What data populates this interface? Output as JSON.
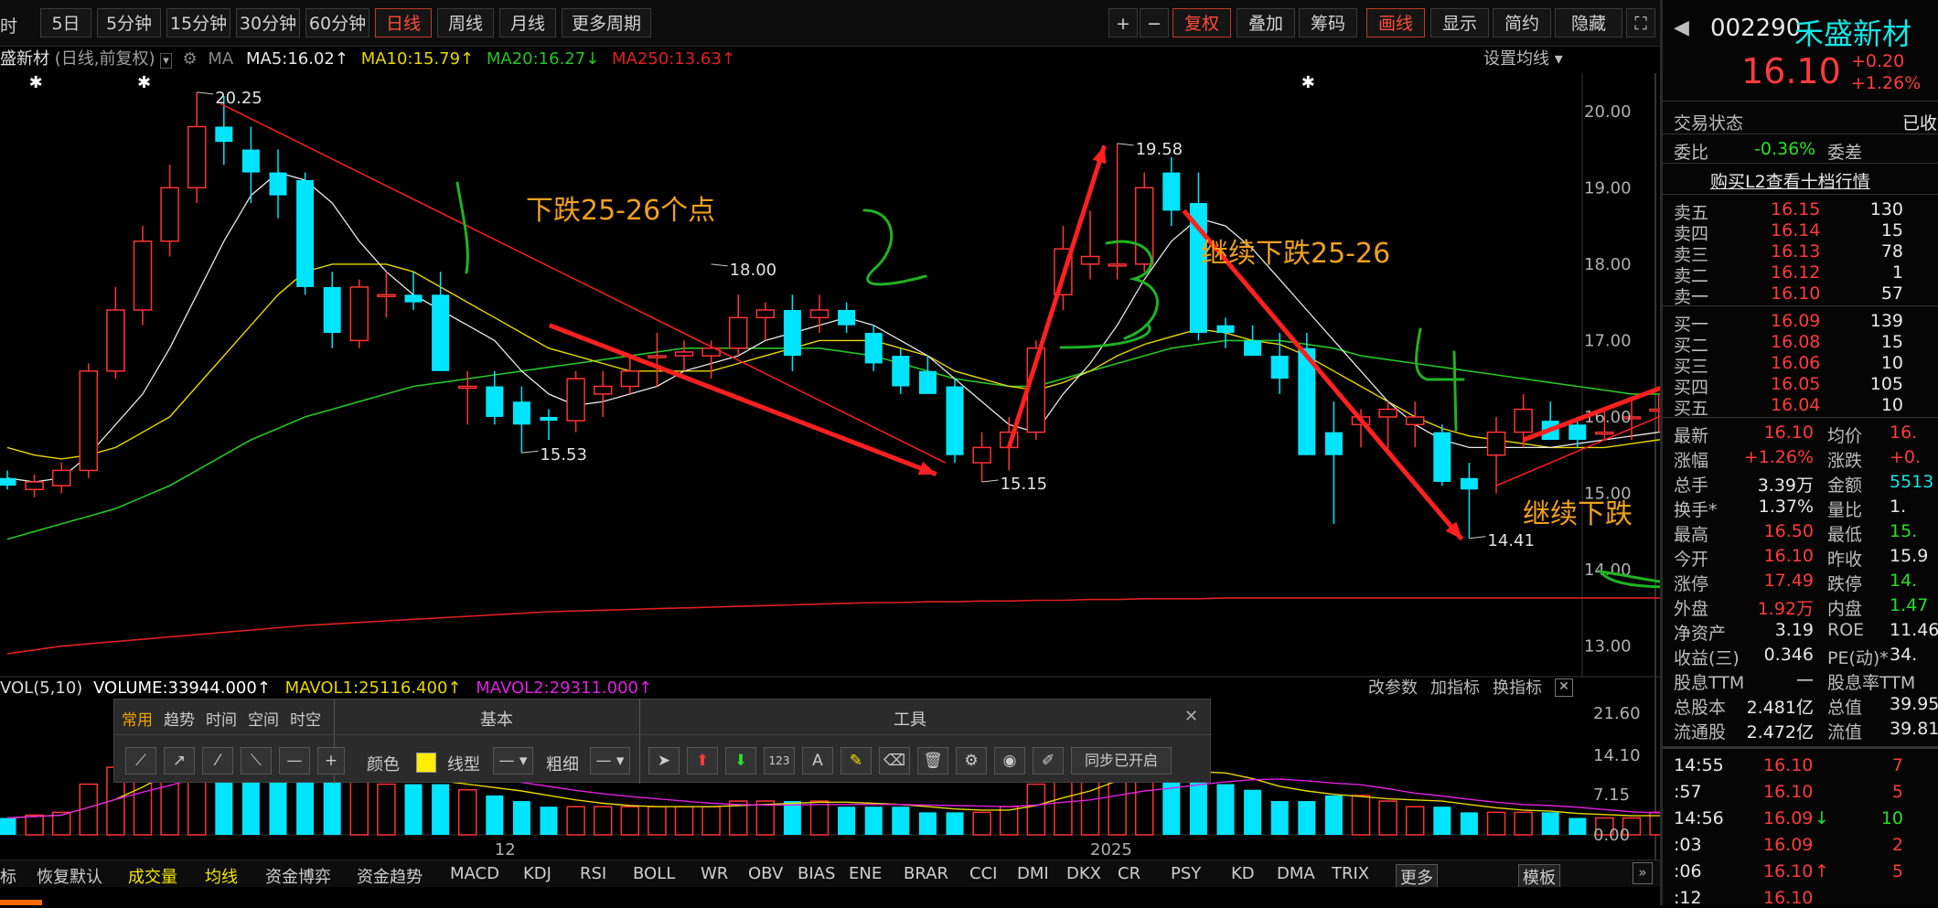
{
  "toolbar": {
    "left_cut": "时",
    "periods": [
      "5日",
      "5分钟",
      "15分钟",
      "30分钟",
      "60分钟",
      "日线",
      "周线",
      "月线",
      "更多周期"
    ],
    "active_period": "日线",
    "zoom_in": "+",
    "zoom_out": "−",
    "buttons": [
      "复权",
      "叠加",
      "筹码",
      "画线",
      "显示",
      "简约",
      "隐藏"
    ]
  },
  "info": {
    "stock_cut": "盛新材",
    "mode": "(日线,前复权)",
    "ma_label": "MA",
    "ma5": "MA5:16.02",
    "ma10": "MA10:15.79",
    "ma20": "MA20:16.27",
    "ma250": "MA250:13.63",
    "settings": "设置均线"
  },
  "chart": {
    "y_ticks": [
      "20.00",
      "19.00",
      "18.00",
      "17.00",
      "16.00",
      "15.00",
      "14.00",
      "13.00"
    ],
    "price_labels": {
      "p1": "20.25",
      "p2": "19.58",
      "p3": "18.00",
      "p4": "15.53",
      "p5": "15.15",
      "p6": "14.41"
    },
    "annotations": {
      "a1": "下跌25-26个点",
      "a2": "继续下跌25-26",
      "a3": "继续下跌"
    },
    "x_labels": {
      "dec": "12",
      "jan": "2025"
    }
  },
  "chart_data": {
    "type": "candlestick",
    "ylim": [
      12.6,
      20.5
    ],
    "ohlc": [
      [
        15.2,
        15.3,
        15.05,
        15.1
      ],
      [
        15.05,
        15.25,
        14.95,
        15.15
      ],
      [
        15.1,
        15.4,
        15.0,
        15.3
      ],
      [
        15.3,
        16.7,
        15.2,
        16.6
      ],
      [
        16.6,
        17.7,
        16.5,
        17.4
      ],
      [
        17.4,
        18.5,
        17.2,
        18.3
      ],
      [
        18.3,
        19.3,
        18.1,
        19.0
      ],
      [
        19.0,
        20.25,
        18.8,
        19.8
      ],
      [
        19.8,
        20.2,
        19.3,
        19.6
      ],
      [
        19.5,
        19.8,
        18.8,
        19.2
      ],
      [
        19.2,
        19.5,
        18.6,
        18.9
      ],
      [
        19.1,
        19.2,
        17.6,
        17.7
      ],
      [
        17.7,
        17.9,
        16.9,
        17.1
      ],
      [
        17.0,
        17.8,
        16.9,
        17.7
      ],
      [
        17.6,
        17.9,
        17.3,
        17.6
      ],
      [
        17.6,
        17.9,
        17.4,
        17.5
      ],
      [
        17.6,
        17.9,
        16.6,
        16.6
      ],
      [
        16.4,
        16.6,
        15.9,
        16.4
      ],
      [
        16.4,
        16.6,
        15.9,
        16.0
      ],
      [
        16.2,
        16.4,
        15.53,
        15.9
      ],
      [
        16.0,
        16.1,
        15.7,
        15.95
      ],
      [
        15.95,
        16.6,
        15.8,
        16.5
      ],
      [
        16.3,
        16.6,
        16.0,
        16.4
      ],
      [
        16.4,
        16.8,
        16.3,
        16.6
      ],
      [
        16.8,
        17.1,
        16.4,
        16.8
      ],
      [
        16.8,
        17.0,
        16.6,
        16.85
      ],
      [
        16.8,
        17.0,
        16.5,
        16.9
      ],
      [
        16.9,
        17.6,
        16.8,
        17.3
      ],
      [
        17.3,
        17.5,
        17.0,
        17.4
      ],
      [
        17.4,
        17.6,
        16.6,
        16.8
      ],
      [
        17.3,
        17.6,
        17.1,
        17.4
      ],
      [
        17.4,
        17.5,
        17.1,
        17.2
      ],
      [
        17.1,
        17.2,
        16.6,
        16.7
      ],
      [
        16.8,
        16.9,
        16.3,
        16.4
      ],
      [
        16.6,
        16.8,
        16.3,
        16.3
      ],
      [
        16.4,
        16.5,
        15.4,
        15.5
      ],
      [
        15.4,
        15.8,
        15.15,
        15.6
      ],
      [
        15.6,
        16.0,
        15.3,
        15.8
      ],
      [
        15.8,
        17.0,
        15.7,
        16.9
      ],
      [
        17.6,
        18.5,
        17.4,
        18.2
      ],
      [
        18.0,
        18.7,
        17.8,
        18.1
      ],
      [
        18.0,
        19.58,
        17.8,
        18.0
      ],
      [
        18.0,
        19.2,
        17.9,
        19.0
      ],
      [
        19.2,
        19.4,
        18.5,
        18.7
      ],
      [
        18.8,
        19.2,
        17.0,
        17.1
      ],
      [
        17.2,
        17.3,
        16.9,
        17.1
      ],
      [
        17.0,
        17.2,
        16.8,
        16.8
      ],
      [
        16.8,
        17.1,
        16.3,
        16.5
      ],
      [
        16.9,
        17.1,
        15.5,
        15.5
      ],
      [
        15.8,
        16.2,
        14.6,
        15.5
      ],
      [
        15.9,
        16.1,
        15.6,
        16.0
      ],
      [
        16.0,
        16.2,
        15.5,
        16.1
      ],
      [
        15.9,
        16.2,
        15.6,
        16.0
      ],
      [
        15.8,
        15.9,
        15.1,
        15.15
      ],
      [
        15.2,
        15.4,
        14.41,
        15.05
      ],
      [
        15.5,
        16.0,
        15.0,
        15.8
      ],
      [
        15.8,
        16.3,
        15.6,
        16.1
      ],
      [
        15.95,
        16.2,
        15.7,
        15.7
      ],
      [
        15.9,
        16.0,
        15.6,
        15.7
      ],
      [
        15.8,
        16.1,
        15.7,
        15.8
      ],
      [
        16.0,
        16.2,
        15.7,
        16.0
      ],
      [
        16.1,
        16.3,
        15.8,
        16.1
      ],
      [
        16.1,
        16.5,
        15.7,
        16.4
      ],
      [
        16.12,
        16.4,
        15.8,
        15.9
      ],
      [
        16.0,
        16.15,
        15.95,
        16.1
      ]
    ],
    "ma5": [
      15.2,
      15.15,
      15.2,
      15.5,
      15.9,
      16.3,
      16.9,
      17.6,
      18.3,
      18.9,
      19.2,
      19.1,
      18.8,
      18.3,
      17.9,
      17.6,
      17.4,
      17.2,
      17.0,
      16.6,
      16.3,
      16.15,
      16.2,
      16.3,
      16.4,
      16.6,
      16.7,
      16.8,
      17.0,
      17.1,
      17.2,
      17.3,
      17.2,
      17.0,
      16.8,
      16.5,
      16.2,
      15.9,
      15.8,
      16.3,
      16.7,
      17.2,
      17.8,
      18.3,
      18.6,
      18.5,
      18.2,
      17.8,
      17.4,
      17.0,
      16.6,
      16.2,
      15.9,
      15.7,
      15.6,
      15.6,
      15.6,
      15.6,
      15.65,
      15.7,
      15.75,
      15.8,
      15.9,
      16.0,
      16.05
    ],
    "ma10": [
      15.6,
      15.5,
      15.45,
      15.5,
      15.6,
      15.8,
      16.0,
      16.4,
      16.8,
      17.2,
      17.6,
      17.9,
      18.0,
      18.0,
      18.0,
      17.9,
      17.7,
      17.5,
      17.3,
      17.1,
      16.9,
      16.8,
      16.7,
      16.6,
      16.6,
      16.6,
      16.6,
      16.7,
      16.8,
      16.9,
      17.0,
      17.0,
      17.0,
      16.9,
      16.8,
      16.6,
      16.5,
      16.4,
      16.35,
      16.45,
      16.6,
      16.8,
      16.95,
      17.05,
      17.15,
      17.1,
      17.0,
      16.95,
      16.8,
      16.6,
      16.4,
      16.2,
      16.0,
      15.85,
      15.75,
      15.7,
      15.65,
      15.6,
      15.6,
      15.6,
      15.65,
      15.7,
      15.75,
      15.75,
      15.8
    ],
    "ma20": [
      14.4,
      14.5,
      14.6,
      14.7,
      14.8,
      14.95,
      15.1,
      15.3,
      15.5,
      15.7,
      15.85,
      16.0,
      16.1,
      16.2,
      16.3,
      16.4,
      16.45,
      16.5,
      16.55,
      16.6,
      16.65,
      16.7,
      16.75,
      16.8,
      16.85,
      16.9,
      16.9,
      16.9,
      16.9,
      16.9,
      16.9,
      16.85,
      16.8,
      16.7,
      16.6,
      16.5,
      16.45,
      16.4,
      16.4,
      16.5,
      16.6,
      16.7,
      16.8,
      16.9,
      16.95,
      17.0,
      17.0,
      17.0,
      16.95,
      16.9,
      16.8,
      16.75,
      16.7,
      16.65,
      16.6,
      16.55,
      16.5,
      16.45,
      16.4,
      16.35,
      16.3,
      16.3,
      16.28,
      16.27,
      16.27
    ],
    "ma250": [
      12.9,
      12.95,
      13.0,
      13.03,
      13.06,
      13.09,
      13.12,
      13.15,
      13.18,
      13.21,
      13.24,
      13.27,
      13.29,
      13.31,
      13.33,
      13.35,
      13.37,
      13.39,
      13.41,
      13.43,
      13.45,
      13.46,
      13.47,
      13.48,
      13.49,
      13.5,
      13.51,
      13.52,
      13.53,
      13.54,
      13.55,
      13.56,
      13.57,
      13.57,
      13.58,
      13.58,
      13.59,
      13.59,
      13.6,
      13.6,
      13.61,
      13.61,
      13.62,
      13.62,
      13.62,
      13.63,
      13.63,
      13.63,
      13.63,
      13.63,
      13.63,
      13.63,
      13.63,
      13.63,
      13.63,
      13.63,
      13.63,
      13.63,
      13.63,
      13.63,
      13.63,
      13.63,
      13.63,
      13.63,
      13.63
    ],
    "volume": [
      3,
      3.5,
      4,
      9,
      12,
      14,
      16,
      19,
      14,
      13,
      12,
      12,
      11,
      10,
      9,
      9,
      9,
      8,
      7,
      6,
      5,
      5,
      5,
      5,
      5,
      5,
      5,
      6,
      6,
      6,
      6,
      5,
      5,
      5,
      4,
      4,
      4,
      5,
      9,
      11,
      10,
      13,
      13,
      10,
      10,
      9,
      8,
      6,
      6,
      7,
      7,
      6,
      5,
      5,
      4,
      4,
      4,
      4,
      3,
      3,
      3,
      4,
      4,
      3,
      3
    ],
    "vol_ticks": [
      "21.60",
      "14.10",
      "7.15",
      "0.00"
    ]
  },
  "volume": {
    "vol_label": "VOL(5,10)",
    "volume": "VOLUME:33944.000",
    "mavol1": "MAVOL1:25116.400",
    "mavol2": "MAVOL2:29311.000",
    "params": "改参数",
    "add": "加指标",
    "switch": "换指标"
  },
  "tool_panel": {
    "tabs": [
      "常用",
      "趋势",
      "时间",
      "空间",
      "时空"
    ],
    "basic_title": "基本",
    "tools_title": "工具",
    "color_label": "颜色",
    "line_type_label": "线型",
    "thickness_label": "粗细",
    "sync_label": "同步已开启",
    "num_label": "123"
  },
  "bottom_tabs": [
    "标",
    "恢复默认",
    "成交量",
    "均线",
    "资金博弈",
    "资金趋势",
    "MACD",
    "KDJ",
    "RSI",
    "BOLL",
    "WR",
    "OBV",
    "BIAS",
    "ENE",
    "BRAR",
    "CCI",
    "DMI",
    "DKX",
    "CR",
    "PSY",
    "KD",
    "DMA",
    "TRIX",
    "更多",
    "模板"
  ],
  "quote": {
    "code": "002290",
    "name": "禾盛新材",
    "price": "16.10",
    "change": "+0.20",
    "change_pct": "+1.26%",
    "status_label": "交易状态",
    "status_value": "已收",
    "wb_label": "委比",
    "wb_value": "-0.36%",
    "wc_label": "委差",
    "l2": "购买L2查看十档行情",
    "asks": [
      {
        "label": "卖五",
        "price": "16.15",
        "vol": "130"
      },
      {
        "label": "卖四",
        "price": "16.14",
        "vol": "15"
      },
      {
        "label": "卖三",
        "price": "16.13",
        "vol": "78"
      },
      {
        "label": "卖二",
        "price": "16.12",
        "vol": "1"
      },
      {
        "label": "卖一",
        "price": "16.10",
        "vol": "57"
      }
    ],
    "bids": [
      {
        "label": "买一",
        "price": "16.09",
        "vol": "139"
      },
      {
        "label": "买二",
        "price": "16.08",
        "vol": "15"
      },
      {
        "label": "买三",
        "price": "16.06",
        "vol": "10"
      },
      {
        "label": "买四",
        "price": "16.05",
        "vol": "105"
      },
      {
        "label": "买五",
        "price": "16.04",
        "vol": "10"
      }
    ],
    "stats": [
      {
        "l1": "最新",
        "v1": "16.10",
        "l2": "均价",
        "v2": "16."
      },
      {
        "l1": "涨幅",
        "v1": "+1.26%",
        "l2": "涨跌",
        "v2": "+0."
      },
      {
        "l1": "总手",
        "v1": "3.39万",
        "l2": "金额",
        "v2": "5513"
      },
      {
        "l1": "换手*",
        "v1": "1.37%",
        "l2": "量比",
        "v2": "1."
      },
      {
        "l1": "最高",
        "v1": "16.50",
        "l2": "最低",
        "v2": "15."
      },
      {
        "l1": "今开",
        "v1": "16.10",
        "l2": "昨收",
        "v2": "15.9"
      },
      {
        "l1": "涨停",
        "v1": "17.49",
        "l2": "跌停",
        "v2": "14."
      },
      {
        "l1": "外盘",
        "v1": "1.92万",
        "l2": "内盘",
        "v2": "1.47"
      },
      {
        "l1": "净资产",
        "v1": "3.19",
        "l2": "ROE",
        "v2": "11.46"
      },
      {
        "l1": "收益(三)",
        "v1": "0.346",
        "l2": "PE(动)*",
        "v2": "34."
      },
      {
        "l1": "股息TTM",
        "v1": "—",
        "l2": "股息率TTM",
        "v2": ""
      },
      {
        "l1": "总股本",
        "v1": "2.481亿",
        "l2": "总值",
        "v2": "39.95"
      },
      {
        "l1": "流通股",
        "v1": "2.472亿",
        "l2": "流值",
        "v2": "39.81"
      }
    ],
    "ticks": [
      {
        "t": "14:55",
        "p": "16.10",
        "v": "7",
        "arrow": ""
      },
      {
        "t": ":57",
        "p": "16.10",
        "v": "5",
        "arrow": ""
      },
      {
        "t": "14:56",
        "p": "16.09",
        "v": "10",
        "arrow": "↓"
      },
      {
        "t": ":03",
        "p": "16.09",
        "v": "2",
        "arrow": ""
      },
      {
        "t": ":06",
        "p": "16.10",
        "v": "5",
        "arrow": "↑"
      },
      {
        "t": ":12",
        "p": "16.10",
        "v": "",
        "arrow": ""
      }
    ]
  },
  "colors": {
    "up": "#ff3333",
    "down": "#00e5ff",
    "ma5": "#e8e8e8",
    "ma10": "#e8d800",
    "ma20": "#27c427",
    "ma250": "#e02020",
    "accent": "#ff4d3a"
  }
}
